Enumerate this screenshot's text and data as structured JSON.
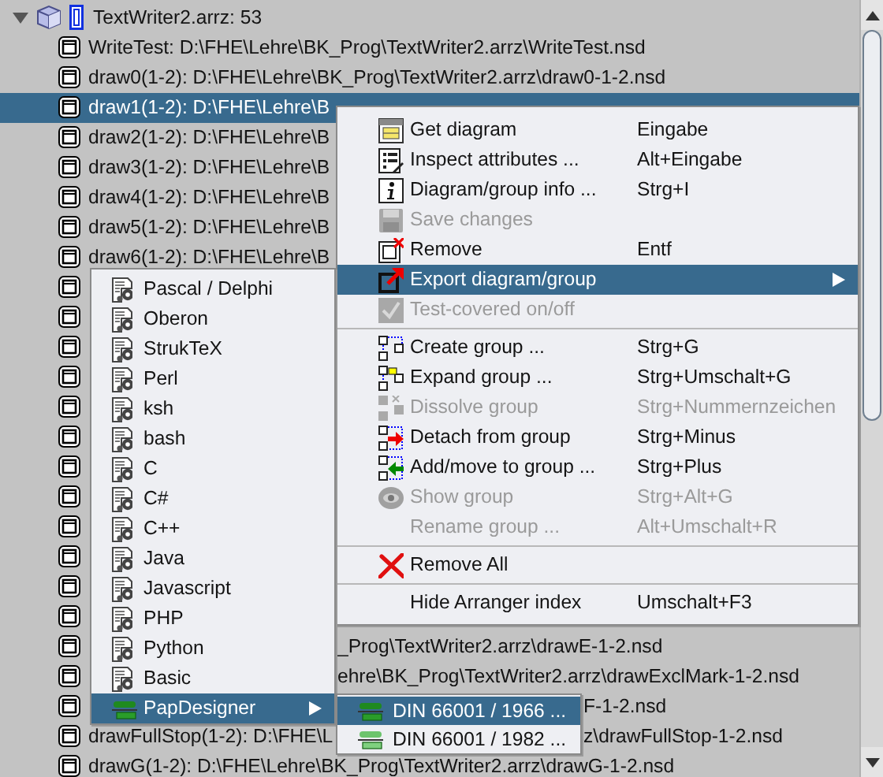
{
  "tree": {
    "root": {
      "label": "TextWriter2.arrz: 53",
      "expanded": true
    },
    "rows": [
      {
        "kind": "full",
        "text": "WriteTest: D:\\FHE\\Lehre\\BK_Prog\\TextWriter2.arrz\\WriteTest.nsd",
        "selected": false
      },
      {
        "kind": "full",
        "text": "draw0(1-2): D:\\FHE\\Lehre\\BK_Prog\\TextWriter2.arrz\\draw0-1-2.nsd",
        "selected": false
      },
      {
        "kind": "full",
        "text": "draw1(1-2): D:\\FHE\\Lehre\\B",
        "selected": true
      },
      {
        "kind": "full",
        "text": "draw2(1-2): D:\\FHE\\Lehre\\B",
        "selected": false
      },
      {
        "kind": "full",
        "text": "draw3(1-2): D:\\FHE\\Lehre\\B",
        "selected": false
      },
      {
        "kind": "full",
        "text": "draw4(1-2): D:\\FHE\\Lehre\\B",
        "selected": false
      },
      {
        "kind": "full",
        "text": "draw5(1-2): D:\\FHE\\Lehre\\B",
        "selected": false
      },
      {
        "kind": "full",
        "text": "draw6(1-2): D:\\FHE\\Lehre\\B",
        "selected": false
      },
      {
        "kind": "icon",
        "selected": false
      },
      {
        "kind": "icon",
        "selected": false
      },
      {
        "kind": "icon",
        "selected": false
      },
      {
        "kind": "icon",
        "selected": false
      },
      {
        "kind": "icon",
        "selected": false
      },
      {
        "kind": "icon",
        "selected": false
      },
      {
        "kind": "icon",
        "selected": false
      },
      {
        "kind": "icon",
        "selected": false
      },
      {
        "kind": "icon",
        "selected": false
      },
      {
        "kind": "icon",
        "selected": false
      },
      {
        "kind": "icon",
        "selected": false
      },
      {
        "kind": "icon",
        "selected": false
      },
      {
        "kind": "tail",
        "tail": "_Prog\\TextWriter2.arrz\\drawE-1-2.nsd",
        "selected": false
      },
      {
        "kind": "tail",
        "tail": "ehre\\BK_Prog\\TextWriter2.arrz\\drawExclMark-1-2.nsd",
        "selected": false
      },
      {
        "kind": "tail",
        "tail": "F-1-2.nsd",
        "selected": false
      },
      {
        "kind": "split",
        "text": "drawFullStop(1-2): D:\\FHE\\L",
        "tail": "z\\drawFullStop-1-2.nsd",
        "selected": false
      },
      {
        "kind": "full",
        "text": "drawG(1-2): D:\\FHE\\Lehre\\BK_Prog\\TextWriter2.arrz\\drawG-1-2.nsd",
        "selected": false
      }
    ]
  },
  "context_menu": {
    "items": [
      {
        "kind": "item",
        "label": "Get diagram",
        "shortcut": "Eingabe",
        "disabled": false,
        "selected": false,
        "submenu": false
      },
      {
        "kind": "item",
        "label": "Inspect attributes ...",
        "shortcut": "Alt+Eingabe",
        "disabled": false,
        "selected": false,
        "submenu": false
      },
      {
        "kind": "item",
        "label": "Diagram/group info ...",
        "shortcut": "Strg+I",
        "disabled": false,
        "selected": false,
        "submenu": false
      },
      {
        "kind": "item",
        "label": "Save changes",
        "disabled": true,
        "selected": false,
        "submenu": false
      },
      {
        "kind": "item",
        "label": "Remove",
        "shortcut": "Entf",
        "disabled": false,
        "selected": false,
        "submenu": false
      },
      {
        "kind": "item",
        "label": "Export diagram/group",
        "disabled": false,
        "selected": true,
        "submenu": true
      },
      {
        "kind": "item",
        "label": "Test-covered on/off",
        "disabled": true,
        "selected": false,
        "submenu": false
      },
      {
        "kind": "separator"
      },
      {
        "kind": "item",
        "label": "Create group ...",
        "shortcut": "Strg+G",
        "disabled": false,
        "selected": false,
        "submenu": false
      },
      {
        "kind": "item",
        "label": "Expand group ...",
        "shortcut": "Strg+Umschalt+G",
        "disabled": false,
        "selected": false,
        "submenu": false
      },
      {
        "kind": "item",
        "label": "Dissolve group",
        "shortcut": "Strg+Nummernzeichen",
        "disabled": true,
        "selected": false,
        "submenu": false
      },
      {
        "kind": "item",
        "label": "Detach from group",
        "shortcut": "Strg+Minus",
        "disabled": false,
        "selected": false,
        "submenu": false
      },
      {
        "kind": "item",
        "label": "Add/move to group ...",
        "shortcut": "Strg+Plus",
        "disabled": false,
        "selected": false,
        "submenu": false
      },
      {
        "kind": "item",
        "label": "Show group",
        "shortcut": "Strg+Alt+G",
        "disabled": true,
        "selected": false,
        "submenu": false
      },
      {
        "kind": "item",
        "label": "Rename group ...",
        "shortcut": "Alt+Umschalt+R",
        "disabled": true,
        "selected": false,
        "submenu": false
      },
      {
        "kind": "separator"
      },
      {
        "kind": "item",
        "label": "Remove All",
        "disabled": false,
        "selected": false,
        "submenu": false
      },
      {
        "kind": "separator"
      },
      {
        "kind": "item",
        "label": "Hide Arranger index",
        "shortcut": "Umschalt+F3",
        "disabled": false,
        "selected": false,
        "submenu": false
      }
    ]
  },
  "export_submenu": {
    "items": [
      {
        "label": "Pascal / Delphi",
        "selected": false,
        "submenu": false
      },
      {
        "label": "Oberon",
        "selected": false,
        "submenu": false
      },
      {
        "label": "StrukTeX",
        "selected": false,
        "submenu": false
      },
      {
        "label": "Perl",
        "selected": false,
        "submenu": false
      },
      {
        "label": "ksh",
        "selected": false,
        "submenu": false
      },
      {
        "label": "bash",
        "selected": false,
        "submenu": false
      },
      {
        "label": "C",
        "selected": false,
        "submenu": false
      },
      {
        "label": "C#",
        "selected": false,
        "submenu": false
      },
      {
        "label": "C++",
        "selected": false,
        "submenu": false
      },
      {
        "label": "Java",
        "selected": false,
        "submenu": false
      },
      {
        "label": "Javascript",
        "selected": false,
        "submenu": false
      },
      {
        "label": "PHP",
        "selected": false,
        "submenu": false
      },
      {
        "label": "Python",
        "selected": false,
        "submenu": false
      },
      {
        "label": "Basic",
        "selected": false,
        "submenu": false
      },
      {
        "label": "PapDesigner",
        "selected": true,
        "submenu": true
      }
    ]
  },
  "papdesigner_submenu": {
    "items": [
      {
        "label": "DIN 66001 / 1966 ...",
        "selected": true
      },
      {
        "label": "DIN 66001 / 1982 ...",
        "selected": false
      }
    ]
  }
}
